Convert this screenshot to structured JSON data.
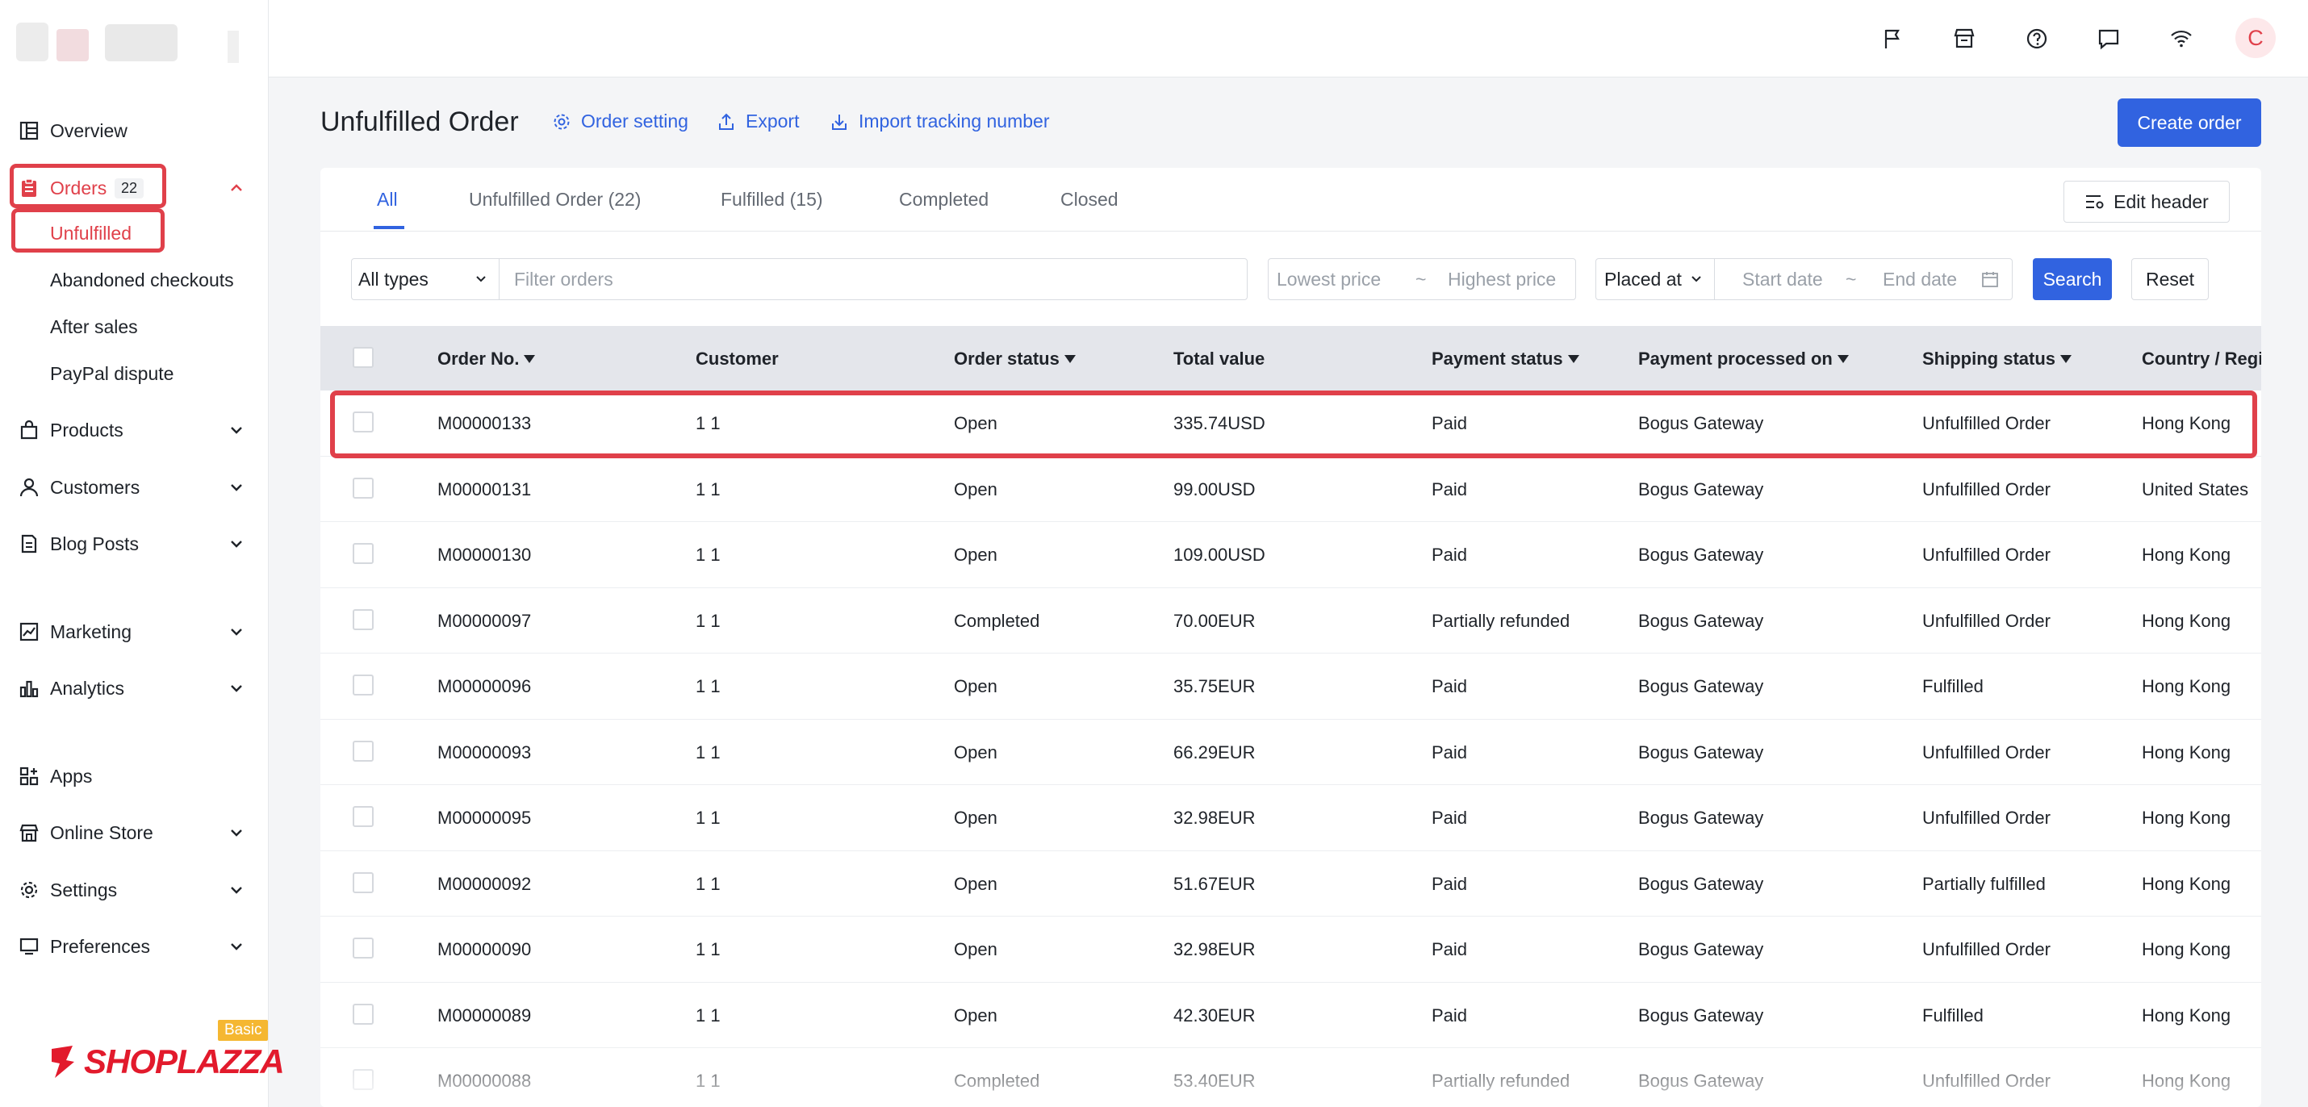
{
  "sidebar": {
    "items": {
      "overview": "Overview",
      "orders": "Orders",
      "orders_badge": "22",
      "products": "Products",
      "customers": "Customers",
      "blog_posts": "Blog Posts",
      "marketing": "Marketing",
      "analytics": "Analytics",
      "apps": "Apps",
      "online_store": "Online Store",
      "settings": "Settings",
      "preferences": "Preferences"
    },
    "orders_sub": {
      "unfulfilled": "Unfulfilled",
      "abandoned": "Abandoned checkouts",
      "after_sales": "After sales",
      "paypal": "PayPal dispute"
    },
    "brand": "SHOPLAZZA",
    "plan_tag": "Basic",
    "accent_color": "#e0404a"
  },
  "topbar": {
    "icons": [
      "flag-icon",
      "store-icon",
      "help-icon",
      "message-icon",
      "wifi-icon"
    ],
    "avatar_letter": "C"
  },
  "header": {
    "title": "Unfulfilled Order",
    "order_setting": "Order setting",
    "export": "Export",
    "import_tracking": "Import tracking number",
    "create_order": "Create order",
    "primary_color": "#3163e0"
  },
  "tabs": {
    "all": "All",
    "unfulfilled": "Unfulfilled Order  (22)",
    "fulfilled": "Fulfilled  (15)",
    "completed": "Completed",
    "closed": "Closed",
    "edit_header": "Edit header"
  },
  "filters": {
    "type": "All types",
    "search_placeholder": "Filter orders",
    "lowest_price": "Lowest price",
    "tilde": "~",
    "highest_price": "Highest price",
    "placed_at": "Placed at",
    "start_date": "Start date",
    "end_date": "End date",
    "search": "Search",
    "reset": "Reset"
  },
  "table": {
    "columns": {
      "order_no": "Order No.",
      "customer": "Customer",
      "order_status": "Order status",
      "total_value": "Total value",
      "payment_status": "Payment status",
      "payment_processed_on": "Payment processed on",
      "shipping_status": "Shipping status",
      "country": "Country / Regi"
    },
    "rows": [
      {
        "order_no": "M00000133",
        "customer": "1 1",
        "order_status": "Open",
        "total": "335.74USD",
        "payment": "Paid",
        "gateway": "Bogus Gateway",
        "shipping": "Unfulfilled Order",
        "country": "Hong Kong"
      },
      {
        "order_no": "M00000131",
        "customer": "1 1",
        "order_status": "Open",
        "total": "99.00USD",
        "payment": "Paid",
        "gateway": "Bogus Gateway",
        "shipping": "Unfulfilled Order",
        "country": "United States"
      },
      {
        "order_no": "M00000130",
        "customer": "1 1",
        "order_status": "Open",
        "total": "109.00USD",
        "payment": "Paid",
        "gateway": "Bogus Gateway",
        "shipping": "Unfulfilled Order",
        "country": "Hong Kong"
      },
      {
        "order_no": "M00000097",
        "customer": "1 1",
        "order_status": "Completed",
        "total": "70.00EUR",
        "payment": "Partially refunded",
        "gateway": "Bogus Gateway",
        "shipping": "Unfulfilled Order",
        "country": "Hong Kong"
      },
      {
        "order_no": "M00000096",
        "customer": "1 1",
        "order_status": "Open",
        "total": "35.75EUR",
        "payment": "Paid",
        "gateway": "Bogus Gateway",
        "shipping": "Fulfilled",
        "country": "Hong Kong"
      },
      {
        "order_no": "M00000093",
        "customer": "1 1",
        "order_status": "Open",
        "total": "66.29EUR",
        "payment": "Paid",
        "gateway": "Bogus Gateway",
        "shipping": "Unfulfilled Order",
        "country": "Hong Kong"
      },
      {
        "order_no": "M00000095",
        "customer": "1 1",
        "order_status": "Open",
        "total": "32.98EUR",
        "payment": "Paid",
        "gateway": "Bogus Gateway",
        "shipping": "Unfulfilled Order",
        "country": "Hong Kong"
      },
      {
        "order_no": "M00000092",
        "customer": "1 1",
        "order_status": "Open",
        "total": "51.67EUR",
        "payment": "Paid",
        "gateway": "Bogus Gateway",
        "shipping": "Partially fulfilled",
        "country": "Hong Kong"
      },
      {
        "order_no": "M00000090",
        "customer": "1 1",
        "order_status": "Open",
        "total": "32.98EUR",
        "payment": "Paid",
        "gateway": "Bogus Gateway",
        "shipping": "Unfulfilled Order",
        "country": "Hong Kong"
      },
      {
        "order_no": "M00000089",
        "customer": "1 1",
        "order_status": "Open",
        "total": "42.30EUR",
        "payment": "Paid",
        "gateway": "Bogus Gateway",
        "shipping": "Fulfilled",
        "country": "Hong Kong"
      },
      {
        "order_no": "M00000088",
        "customer": "1 1",
        "order_status": "Completed",
        "total": "53.40EUR",
        "payment": "Partially refunded",
        "gateway": "Bogus Gateway",
        "shipping": "Unfulfilled Order",
        "country": "Hong Kong"
      }
    ]
  }
}
